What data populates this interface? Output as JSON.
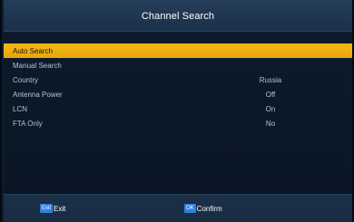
{
  "header": {
    "title": "Channel Search"
  },
  "menu": {
    "items": [
      {
        "label": "Auto Search",
        "value": ""
      },
      {
        "label": "Manual Search",
        "value": ""
      },
      {
        "label": "Country",
        "value": "Russia"
      },
      {
        "label": "Antenna Power",
        "value": "Off"
      },
      {
        "label": "LCN",
        "value": "On"
      },
      {
        "label": "FTA Only",
        "value": "No"
      }
    ],
    "selected_index": 0
  },
  "footer": {
    "exit": {
      "key": "Exit",
      "label": "Exit"
    },
    "confirm": {
      "key": "OK",
      "label": "Confirm"
    }
  },
  "colors": {
    "highlight": "#f3b814",
    "key_badge": "#2f80e0",
    "header_bg": "#1f3550",
    "panel_bg": "#0c1a2b"
  }
}
